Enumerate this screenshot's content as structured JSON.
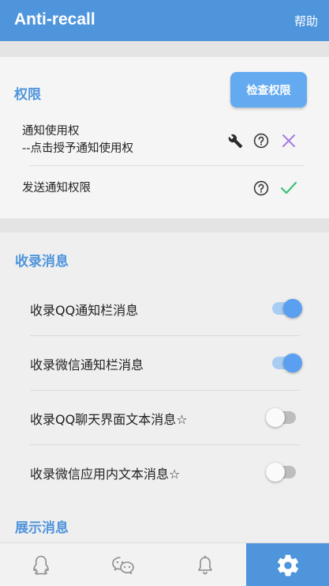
{
  "appbar": {
    "title": "Anti-recall",
    "help": "帮助"
  },
  "permissions": {
    "section_title": "权限",
    "check_button": "检查权限",
    "rows": [
      {
        "line1": "通知使用权",
        "line2": "--点击授予通知使用权",
        "status": "denied"
      },
      {
        "line1": "发送通知权限",
        "status": "granted"
      }
    ]
  },
  "record": {
    "section_title": "收录消息",
    "options": [
      {
        "label": "收录QQ通知栏消息",
        "enabled": true
      },
      {
        "label": "收录微信通知栏消息",
        "enabled": true
      },
      {
        "label": "收录QQ聊天界面文本消息☆",
        "enabled": false
      },
      {
        "label": "收录微信应用内文本消息☆",
        "enabled": false
      }
    ]
  },
  "display": {
    "section_title": "展示消息"
  },
  "nav": {
    "items": [
      {
        "icon": "qq-penguin-icon",
        "active": false
      },
      {
        "icon": "wechat-icon",
        "active": false
      },
      {
        "icon": "bell-icon",
        "active": false
      },
      {
        "icon": "gear-icon",
        "active": true
      }
    ]
  },
  "colors": {
    "primary": "#4f95dc",
    "button": "#64aaf0",
    "check": "#3ec07a",
    "cross": "#a77de0"
  }
}
